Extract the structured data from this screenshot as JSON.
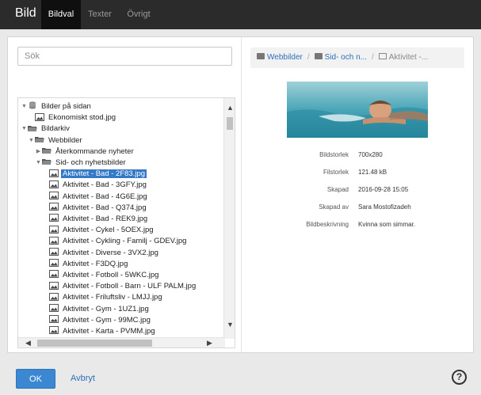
{
  "header": {
    "app_title": "Bild",
    "tabs": [
      {
        "label": "Bildval",
        "active": true
      },
      {
        "label": "Texter",
        "active": false
      },
      {
        "label": "Övrigt",
        "active": false
      }
    ]
  },
  "search": {
    "placeholder": "Sök",
    "value": ""
  },
  "tree": {
    "nodes": [
      {
        "label": "Bilder på sidan",
        "level": 0,
        "toggle": "▼",
        "icon": "database-icon"
      },
      {
        "label": "Ekonomiskt stod.jpg",
        "level": 1,
        "toggle": "",
        "icon": "image-icon"
      },
      {
        "label": "Bildarkiv",
        "level": 0,
        "toggle": "▼",
        "icon": "folder-icon"
      },
      {
        "label": "Webbilder",
        "level": 1,
        "toggle": "▼",
        "icon": "folder-icon"
      },
      {
        "label": "Återkommande nyheter",
        "level": 2,
        "toggle": "▶",
        "icon": "folder-icon"
      },
      {
        "label": "Sid- och nyhetsbilder",
        "level": 2,
        "toggle": "▼",
        "icon": "folder-icon"
      },
      {
        "label": "Aktivitet - Bad - 2F83.jpg",
        "level": 3,
        "toggle": "",
        "icon": "image-icon",
        "selected": true
      },
      {
        "label": "Aktivitet - Bad - 3GFY.jpg",
        "level": 3,
        "toggle": "",
        "icon": "image-icon"
      },
      {
        "label": "Aktivitet - Bad - 4G6E.jpg",
        "level": 3,
        "toggle": "",
        "icon": "image-icon"
      },
      {
        "label": "Aktivitet - Bad - Q374.jpg",
        "level": 3,
        "toggle": "",
        "icon": "image-icon"
      },
      {
        "label": "Aktivitet - Bad - REK9.jpg",
        "level": 3,
        "toggle": "",
        "icon": "image-icon"
      },
      {
        "label": "Aktivitet - Cykel - 5OEX.jpg",
        "level": 3,
        "toggle": "",
        "icon": "image-icon"
      },
      {
        "label": "Aktivitet - Cykling - Familj - GDEV.jpg",
        "level": 3,
        "toggle": "",
        "icon": "image-icon"
      },
      {
        "label": "Aktivitet - Diverse - 3VX2.jpg",
        "level": 3,
        "toggle": "",
        "icon": "image-icon"
      },
      {
        "label": "Aktivitet - F3DQ.jpg",
        "level": 3,
        "toggle": "",
        "icon": "image-icon"
      },
      {
        "label": "Aktivitet - Fotboll - 5WKC.jpg",
        "level": 3,
        "toggle": "",
        "icon": "image-icon"
      },
      {
        "label": "Aktivitet - Fotboll - Barn - ULF PALM.jpg",
        "level": 3,
        "toggle": "",
        "icon": "image-icon"
      },
      {
        "label": "Aktivitet - Friluftsliv - LMJJ.jpg",
        "level": 3,
        "toggle": "",
        "icon": "image-icon"
      },
      {
        "label": "Aktivitet - Gym - 1UZ1.jpg",
        "level": 3,
        "toggle": "",
        "icon": "image-icon"
      },
      {
        "label": "Aktivitet - Gym - 99MC.jpg",
        "level": 3,
        "toggle": "",
        "icon": "image-icon"
      },
      {
        "label": "Aktivitet - Karta - PVMM.jpg",
        "level": 3,
        "toggle": "",
        "icon": "image-icon"
      }
    ]
  },
  "breadcrumb": {
    "items": [
      {
        "label": "Webbilder",
        "icon": "folder-icon"
      },
      {
        "label": "Sid- och n...",
        "icon": "folder-icon"
      },
      {
        "label": "Aktivitet -...",
        "icon": "image-icon"
      }
    ],
    "separator": "/"
  },
  "preview": {
    "alt": "Kvinna som simmar."
  },
  "properties": [
    {
      "label": "Bildstorlek",
      "value": "700x280"
    },
    {
      "label": "Filstorlek",
      "value": "121.48 kB"
    },
    {
      "label": "Skapad",
      "value": "2016-09-28 15:05"
    },
    {
      "label": "Skapad av",
      "value": "Sara Mostofizadeh"
    },
    {
      "label": "Bildbeskrivning",
      "value": "Kvinna som simmar."
    }
  ],
  "footer": {
    "ok_label": "OK",
    "cancel_label": "Avbryt",
    "help_label": "?"
  },
  "colors": {
    "accent": "#3b87d1",
    "topbar": "#2b2b2b",
    "link": "#2d6fb8",
    "selected": "#3379c7"
  }
}
